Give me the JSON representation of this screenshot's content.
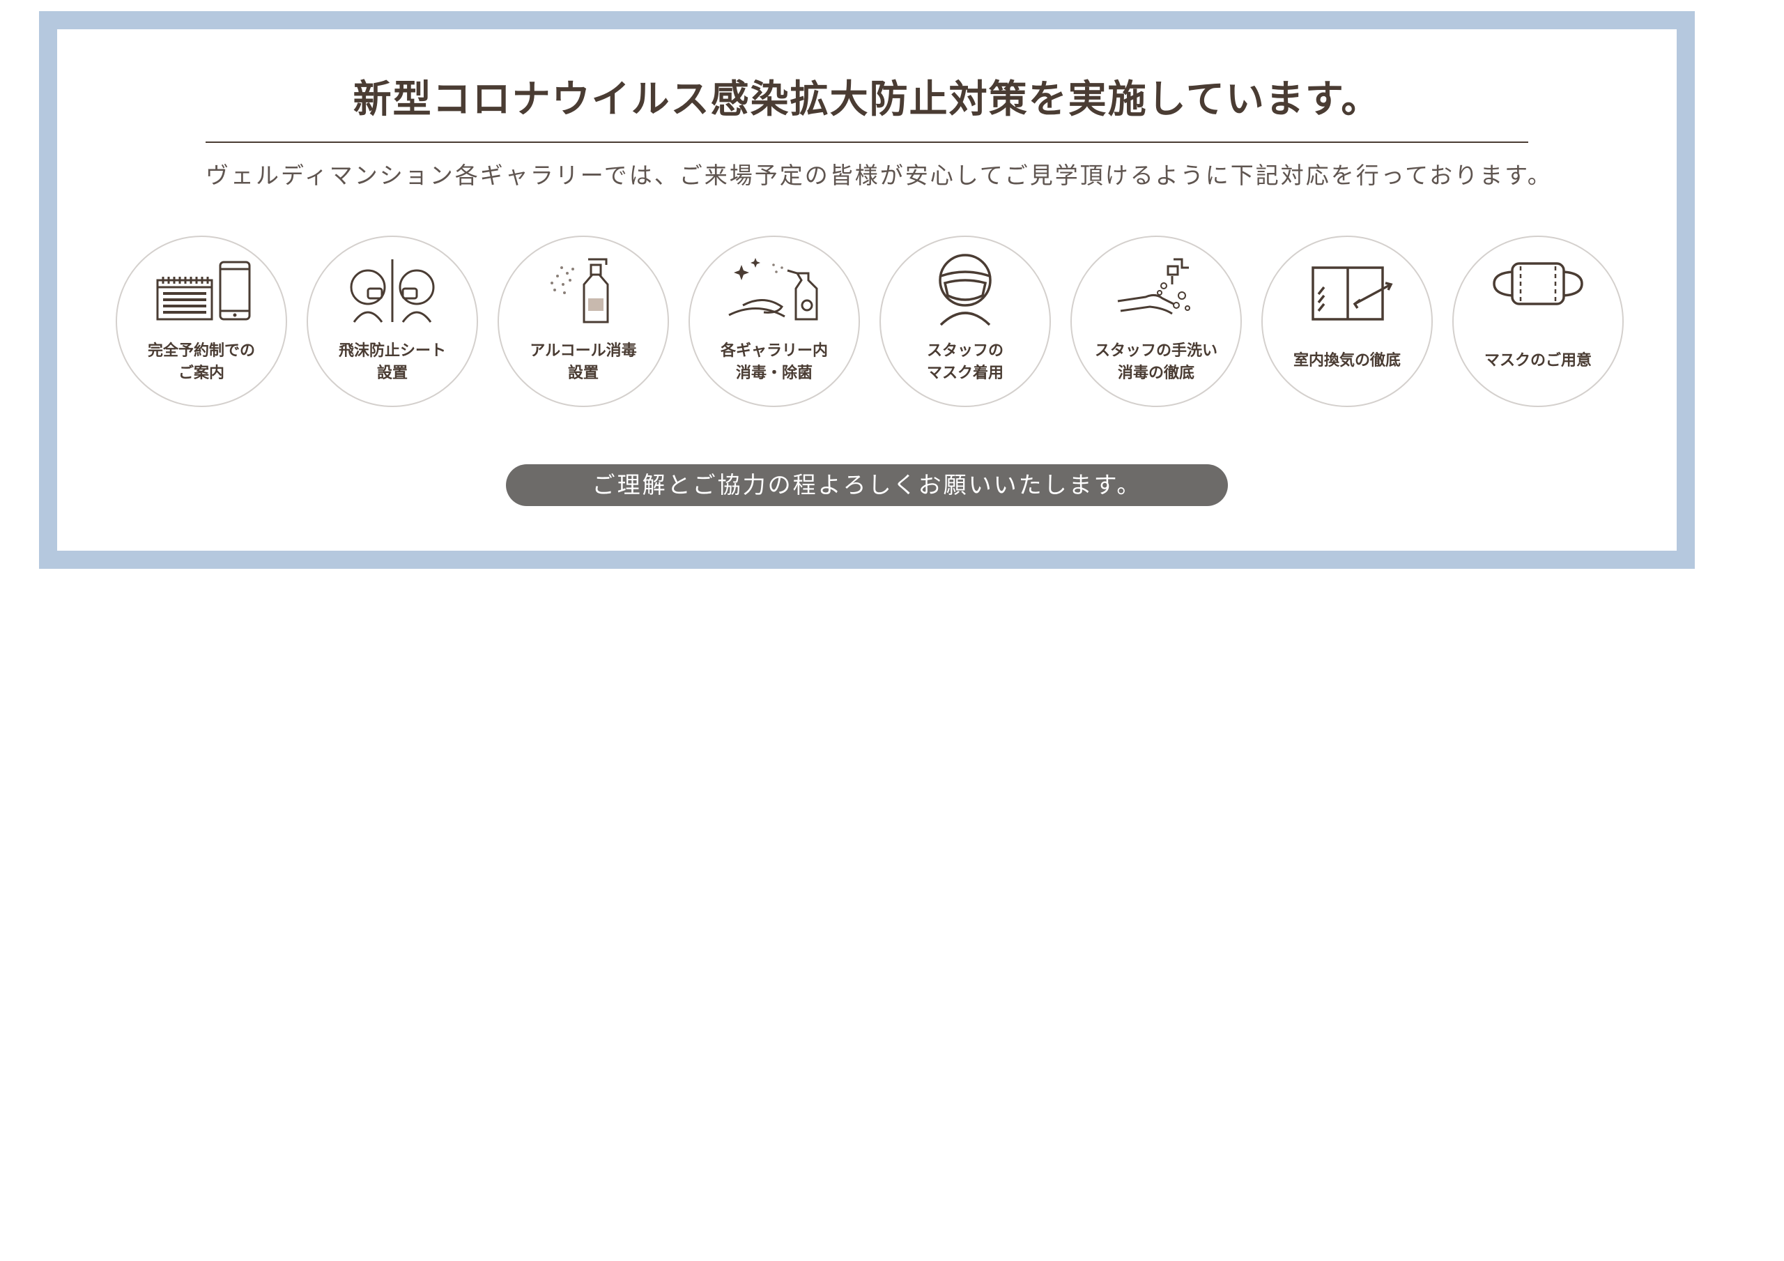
{
  "heading": "新型コロナウイルス感染拡大防止対策を実施しています。",
  "lead": "ヴェルディマンション各ギャラリーでは、ご来場予定の皆様が安心してご見学頂けるように下記対応を行っております。",
  "measures": [
    {
      "line1": "完全予約制での",
      "line2": "ご案内",
      "icon": "calendar-phone-icon"
    },
    {
      "line1": "飛沫防止シート",
      "line2": "設置",
      "icon": "splash-guard-icon"
    },
    {
      "line1": "アルコール消毒",
      "line2": "設置",
      "icon": "alcohol-spray-icon"
    },
    {
      "line1": "各ギャラリー内",
      "line2": "消毒・除菌",
      "icon": "disinfect-cloth-icon"
    },
    {
      "line1": "スタッフの",
      "line2": "マスク着用",
      "icon": "staff-mask-icon"
    },
    {
      "line1": "スタッフの手洗い",
      "line2": "消毒の徹底",
      "icon": "hand-wash-icon"
    },
    {
      "line1": "室内換気の徹底",
      "line2": "",
      "icon": "window-ventilation-icon"
    },
    {
      "line1": "マスクのご用意",
      "line2": "",
      "icon": "face-mask-icon"
    }
  ],
  "closing": "ご理解とご協力の程よろしくお願いいたします。",
  "colors": {
    "frame": "#b5c8de",
    "text": "#4a3c33",
    "pill": "#6d6b69",
    "circle_border": "#d4d0cd"
  }
}
